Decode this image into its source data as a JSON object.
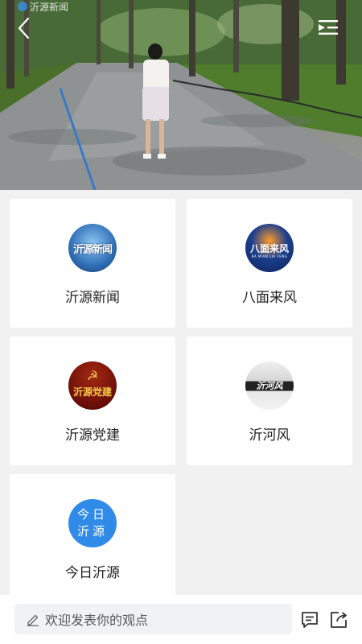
{
  "video": {
    "watermark": "沂源新闻",
    "back_icon": "chevron-left-icon",
    "menu_icon": "playlist-icon"
  },
  "channels": [
    {
      "label": "沂源新闻",
      "logo_text": "沂源新闻",
      "icon": "yiyuan-news-logo"
    },
    {
      "label": "八面来风",
      "logo_text": "八面来风",
      "logo_sub": "BA MIAN LAI FENG",
      "icon": "bamian-laifeng-logo"
    },
    {
      "label": "沂源党建",
      "logo_text": "沂源党建",
      "icon": "yiyuan-party-logo"
    },
    {
      "label": "沂河风",
      "logo_text": "沂河风",
      "icon": "yihe-feng-logo"
    },
    {
      "label": "今日沂源",
      "logo_text": "今日沂源",
      "icon": "jinri-yiyuan-logo"
    }
  ],
  "bottom_bar": {
    "placeholder": "欢迎发表你的观点",
    "comment_icon": "comment-icon",
    "share_icon": "share-icon"
  },
  "colors": {
    "background": "#f1f1f1",
    "card": "#ffffff",
    "accent_blue": "#2f8ae8",
    "text": "#222222"
  }
}
